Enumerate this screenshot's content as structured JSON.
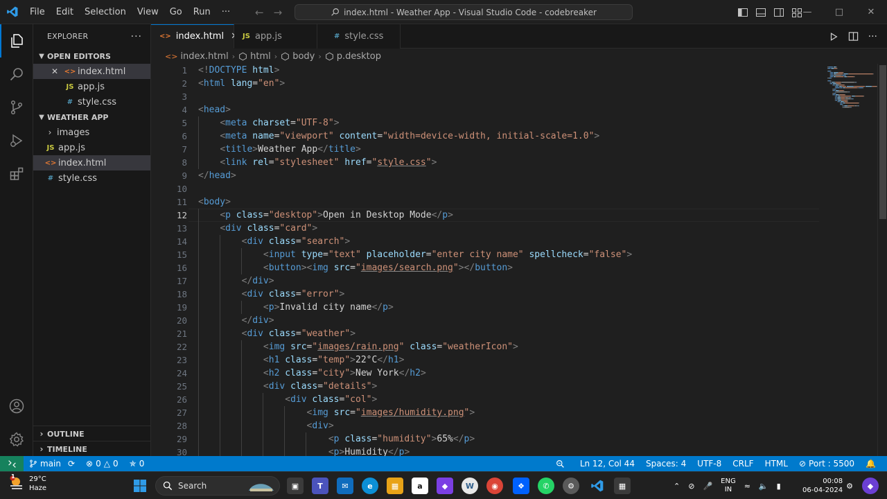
{
  "titlebar": {
    "menu": [
      "File",
      "Edit",
      "Selection",
      "View",
      "Go",
      "Run",
      "···"
    ],
    "command_center": "index.html - Weather App - Visual Studio Code - codebreaker"
  },
  "sidebar": {
    "header": "EXPLORER",
    "open_editors_title": "OPEN EDITORS",
    "open_editors": [
      {
        "name": "index.html",
        "badge": "<>",
        "type": "html",
        "selected": true
      },
      {
        "name": "app.js",
        "badge": "JS",
        "type": "js",
        "selected": false
      },
      {
        "name": "style.css",
        "badge": "#",
        "type": "css",
        "selected": false
      }
    ],
    "project_title": "WEATHER APP",
    "tree": [
      {
        "name": "images",
        "kind": "folder"
      },
      {
        "name": "app.js",
        "badge": "JS",
        "type": "js"
      },
      {
        "name": "index.html",
        "badge": "<>",
        "type": "html",
        "selected": true
      },
      {
        "name": "style.css",
        "badge": "#",
        "type": "css"
      }
    ],
    "outline": "OUTLINE",
    "timeline": "TIMELINE"
  },
  "tabs": [
    {
      "label": "index.html",
      "badge": "<>",
      "type": "html",
      "active": true
    },
    {
      "label": "app.js",
      "badge": "JS",
      "type": "js",
      "active": false
    },
    {
      "label": "style.css",
      "badge": "#",
      "type": "css",
      "active": false
    }
  ],
  "breadcrumb": [
    "index.html",
    "html",
    "body",
    "p.desktop"
  ],
  "editor": {
    "current_line": 12,
    "lines": [
      [
        [
          "tg",
          "<!"
        ],
        [
          "tn",
          "DOCTYPE"
        ],
        [
          "tx",
          " "
        ],
        [
          "at",
          "html"
        ],
        [
          "tg",
          ">"
        ]
      ],
      [
        [
          "tg",
          "<"
        ],
        [
          "tn",
          "html"
        ],
        [
          "tx",
          " "
        ],
        [
          "at",
          "lang"
        ],
        [
          "tx",
          "="
        ],
        [
          "st",
          "\"en\""
        ],
        [
          "tg",
          ">"
        ]
      ],
      [],
      [
        [
          "tg",
          "<"
        ],
        [
          "tn",
          "head"
        ],
        [
          "tg",
          ">"
        ]
      ],
      [
        [
          "tx",
          "    "
        ],
        [
          "tg",
          "<"
        ],
        [
          "tn",
          "meta"
        ],
        [
          "tx",
          " "
        ],
        [
          "at",
          "charset"
        ],
        [
          "tx",
          "="
        ],
        [
          "st",
          "\"UTF-8\""
        ],
        [
          "tg",
          ">"
        ]
      ],
      [
        [
          "tx",
          "    "
        ],
        [
          "tg",
          "<"
        ],
        [
          "tn",
          "meta"
        ],
        [
          "tx",
          " "
        ],
        [
          "at",
          "name"
        ],
        [
          "tx",
          "="
        ],
        [
          "st",
          "\"viewport\""
        ],
        [
          "tx",
          " "
        ],
        [
          "at",
          "content"
        ],
        [
          "tx",
          "="
        ],
        [
          "st",
          "\"width=device-width, initial-scale=1.0\""
        ],
        [
          "tg",
          ">"
        ]
      ],
      [
        [
          "tx",
          "    "
        ],
        [
          "tg",
          "<"
        ],
        [
          "tn",
          "title"
        ],
        [
          "tg",
          ">"
        ],
        [
          "tx",
          "Weather App"
        ],
        [
          "tg",
          "</"
        ],
        [
          "tn",
          "title"
        ],
        [
          "tg",
          ">"
        ]
      ],
      [
        [
          "tx",
          "    "
        ],
        [
          "tg",
          "<"
        ],
        [
          "tn",
          "link"
        ],
        [
          "tx",
          " "
        ],
        [
          "at",
          "rel"
        ],
        [
          "tx",
          "="
        ],
        [
          "st",
          "\"stylesheet\""
        ],
        [
          "tx",
          " "
        ],
        [
          "at",
          "href"
        ],
        [
          "tx",
          "="
        ],
        [
          "st",
          "\""
        ],
        [
          "st ul",
          "style.css"
        ],
        [
          "st",
          "\""
        ],
        [
          "tg",
          ">"
        ]
      ],
      [
        [
          "tg",
          "</"
        ],
        [
          "tn",
          "head"
        ],
        [
          "tg",
          ">"
        ]
      ],
      [],
      [
        [
          "tg",
          "<"
        ],
        [
          "tn",
          "body"
        ],
        [
          "tg",
          ">"
        ]
      ],
      [
        [
          "tx",
          "    "
        ],
        [
          "tg",
          "<"
        ],
        [
          "tn",
          "p"
        ],
        [
          "tx",
          " "
        ],
        [
          "at",
          "class"
        ],
        [
          "tx",
          "="
        ],
        [
          "st",
          "\"desktop\""
        ],
        [
          "tg",
          ">"
        ],
        [
          "tx",
          "Open in Desktop Mode"
        ],
        [
          "tg",
          "</"
        ],
        [
          "tn",
          "p"
        ],
        [
          "tg",
          ">"
        ]
      ],
      [
        [
          "tx",
          "    "
        ],
        [
          "tg",
          "<"
        ],
        [
          "tn",
          "div"
        ],
        [
          "tx",
          " "
        ],
        [
          "at",
          "class"
        ],
        [
          "tx",
          "="
        ],
        [
          "st",
          "\"card\""
        ],
        [
          "tg",
          ">"
        ]
      ],
      [
        [
          "tx",
          "        "
        ],
        [
          "tg",
          "<"
        ],
        [
          "tn",
          "div"
        ],
        [
          "tx",
          " "
        ],
        [
          "at",
          "class"
        ],
        [
          "tx",
          "="
        ],
        [
          "st",
          "\"search\""
        ],
        [
          "tg",
          ">"
        ]
      ],
      [
        [
          "tx",
          "            "
        ],
        [
          "tg",
          "<"
        ],
        [
          "tn",
          "input"
        ],
        [
          "tx",
          " "
        ],
        [
          "at",
          "type"
        ],
        [
          "tx",
          "="
        ],
        [
          "st",
          "\"text\""
        ],
        [
          "tx",
          " "
        ],
        [
          "at",
          "placeholder"
        ],
        [
          "tx",
          "="
        ],
        [
          "st",
          "\"enter city name\""
        ],
        [
          "tx",
          " "
        ],
        [
          "at",
          "spellcheck"
        ],
        [
          "tx",
          "="
        ],
        [
          "st",
          "\"false\""
        ],
        [
          "tg",
          ">"
        ]
      ],
      [
        [
          "tx",
          "            "
        ],
        [
          "tg",
          "<"
        ],
        [
          "tn",
          "button"
        ],
        [
          "tg",
          "><"
        ],
        [
          "tn",
          "img"
        ],
        [
          "tx",
          " "
        ],
        [
          "at",
          "src"
        ],
        [
          "tx",
          "="
        ],
        [
          "st",
          "\""
        ],
        [
          "st ul",
          "images/search.png"
        ],
        [
          "st",
          "\""
        ],
        [
          "tg",
          "></"
        ],
        [
          "tn",
          "button"
        ],
        [
          "tg",
          ">"
        ]
      ],
      [
        [
          "tx",
          "        "
        ],
        [
          "tg",
          "</"
        ],
        [
          "tn",
          "div"
        ],
        [
          "tg",
          ">"
        ]
      ],
      [
        [
          "tx",
          "        "
        ],
        [
          "tg",
          "<"
        ],
        [
          "tn",
          "div"
        ],
        [
          "tx",
          " "
        ],
        [
          "at",
          "class"
        ],
        [
          "tx",
          "="
        ],
        [
          "st",
          "\"error\""
        ],
        [
          "tg",
          ">"
        ]
      ],
      [
        [
          "tx",
          "            "
        ],
        [
          "tg",
          "<"
        ],
        [
          "tn",
          "p"
        ],
        [
          "tg",
          ">"
        ],
        [
          "tx",
          "Invalid city name"
        ],
        [
          "tg",
          "</"
        ],
        [
          "tn",
          "p"
        ],
        [
          "tg",
          ">"
        ]
      ],
      [
        [
          "tx",
          "        "
        ],
        [
          "tg",
          "</"
        ],
        [
          "tn",
          "div"
        ],
        [
          "tg",
          ">"
        ]
      ],
      [
        [
          "tx",
          "        "
        ],
        [
          "tg",
          "<"
        ],
        [
          "tn",
          "div"
        ],
        [
          "tx",
          " "
        ],
        [
          "at",
          "class"
        ],
        [
          "tx",
          "="
        ],
        [
          "st",
          "\"weather\""
        ],
        [
          "tg",
          ">"
        ]
      ],
      [
        [
          "tx",
          "            "
        ],
        [
          "tg",
          "<"
        ],
        [
          "tn",
          "img"
        ],
        [
          "tx",
          " "
        ],
        [
          "at",
          "src"
        ],
        [
          "tx",
          "="
        ],
        [
          "st",
          "\""
        ],
        [
          "st ul",
          "images/rain.png"
        ],
        [
          "st",
          "\""
        ],
        [
          "tx",
          " "
        ],
        [
          "at",
          "class"
        ],
        [
          "tx",
          "="
        ],
        [
          "st",
          "\"weatherIcon\""
        ],
        [
          "tg",
          ">"
        ]
      ],
      [
        [
          "tx",
          "            "
        ],
        [
          "tg",
          "<"
        ],
        [
          "tn",
          "h1"
        ],
        [
          "tx",
          " "
        ],
        [
          "at",
          "class"
        ],
        [
          "tx",
          "="
        ],
        [
          "st",
          "\"temp\""
        ],
        [
          "tg",
          ">"
        ],
        [
          "tx",
          "22°C"
        ],
        [
          "tg",
          "</"
        ],
        [
          "tn",
          "h1"
        ],
        [
          "tg",
          ">"
        ]
      ],
      [
        [
          "tx",
          "            "
        ],
        [
          "tg",
          "<"
        ],
        [
          "tn",
          "h2"
        ],
        [
          "tx",
          " "
        ],
        [
          "at",
          "class"
        ],
        [
          "tx",
          "="
        ],
        [
          "st",
          "\"city\""
        ],
        [
          "tg",
          ">"
        ],
        [
          "tx",
          "New York"
        ],
        [
          "tg",
          "</"
        ],
        [
          "tn",
          "h2"
        ],
        [
          "tg",
          ">"
        ]
      ],
      [
        [
          "tx",
          "            "
        ],
        [
          "tg",
          "<"
        ],
        [
          "tn",
          "div"
        ],
        [
          "tx",
          " "
        ],
        [
          "at",
          "class"
        ],
        [
          "tx",
          "="
        ],
        [
          "st",
          "\"details\""
        ],
        [
          "tg",
          ">"
        ]
      ],
      [
        [
          "tx",
          "                "
        ],
        [
          "tg",
          "<"
        ],
        [
          "tn",
          "div"
        ],
        [
          "tx",
          " "
        ],
        [
          "at",
          "class"
        ],
        [
          "tx",
          "="
        ],
        [
          "st",
          "\"col\""
        ],
        [
          "tg",
          ">"
        ]
      ],
      [
        [
          "tx",
          "                    "
        ],
        [
          "tg",
          "<"
        ],
        [
          "tn",
          "img"
        ],
        [
          "tx",
          " "
        ],
        [
          "at",
          "src"
        ],
        [
          "tx",
          "="
        ],
        [
          "st",
          "\""
        ],
        [
          "st ul",
          "images/humidity.png"
        ],
        [
          "st",
          "\""
        ],
        [
          "tg",
          ">"
        ]
      ],
      [
        [
          "tx",
          "                    "
        ],
        [
          "tg",
          "<"
        ],
        [
          "tn",
          "div"
        ],
        [
          "tg",
          ">"
        ]
      ],
      [
        [
          "tx",
          "                        "
        ],
        [
          "tg",
          "<"
        ],
        [
          "tn",
          "p"
        ],
        [
          "tx",
          " "
        ],
        [
          "at",
          "class"
        ],
        [
          "tx",
          "="
        ],
        [
          "st",
          "\"humidity\""
        ],
        [
          "tg",
          ">"
        ],
        [
          "tx",
          "65%"
        ],
        [
          "tg",
          "</"
        ],
        [
          "tn",
          "p"
        ],
        [
          "tg",
          ">"
        ]
      ],
      [
        [
          "tx",
          "                        "
        ],
        [
          "tg",
          "<"
        ],
        [
          "tn",
          "p"
        ],
        [
          "tg",
          ">"
        ],
        [
          "tx",
          "Humidity"
        ],
        [
          "tg",
          "</"
        ],
        [
          "tn",
          "p"
        ],
        [
          "tg",
          ">"
        ]
      ]
    ]
  },
  "statusbar": {
    "branch": "main",
    "errors": "0",
    "warnings": "0",
    "ports": "0",
    "position": "Ln 12, Col 44",
    "spaces": "Spaces: 4",
    "encoding": "UTF-8",
    "eol": "CRLF",
    "language": "HTML",
    "port": "Port : 5500"
  },
  "taskbar": {
    "weather_temp": "29°C",
    "weather_desc": "Haze",
    "weather_badge": "1",
    "search_label": "Search",
    "lang_1": "ENG",
    "lang_2": "IN",
    "time": "00:08",
    "date": "06-04-2024"
  },
  "colors": {
    "accent": "#0078d4",
    "statusbar": "#007acc",
    "remote": "#16825d"
  }
}
